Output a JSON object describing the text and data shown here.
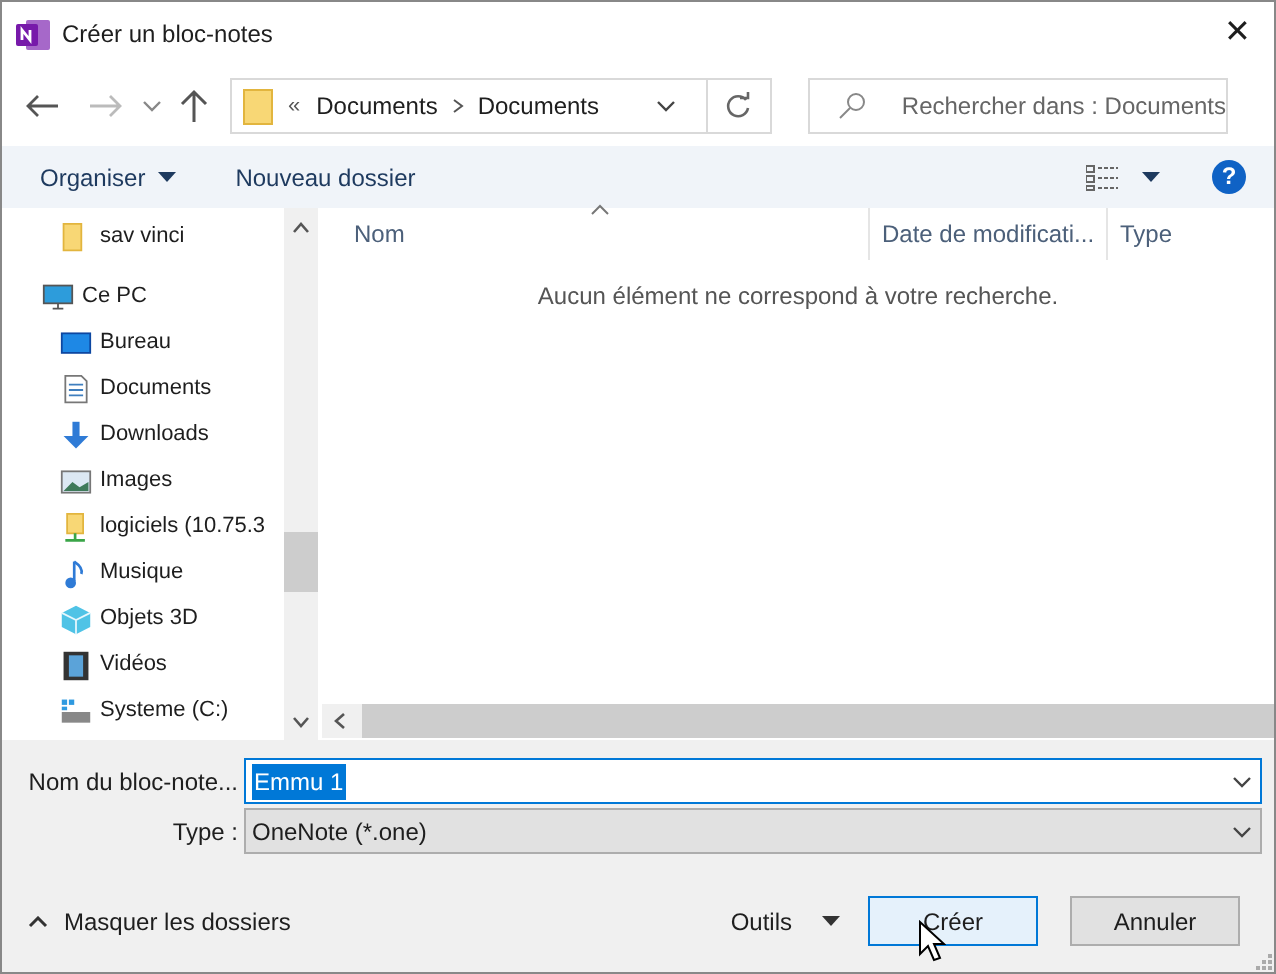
{
  "window": {
    "title": "Créer un bloc-notes",
    "close": "✕"
  },
  "address": {
    "overflow": "«",
    "crumbs": [
      "Documents",
      "Documents"
    ]
  },
  "search": {
    "placeholder": "Rechercher dans : Documents"
  },
  "toolbar": {
    "organize": "Organiser",
    "new_folder": "Nouveau dossier",
    "help": "?"
  },
  "sidebar": {
    "items": [
      {
        "label": "sav vinci",
        "kind": "folder"
      },
      {
        "label": "Ce PC",
        "kind": "pc",
        "children": [
          {
            "label": "Bureau",
            "kind": "desktop"
          },
          {
            "label": "Documents",
            "kind": "documents"
          },
          {
            "label": "Downloads",
            "kind": "download"
          },
          {
            "label": "Images",
            "kind": "images"
          },
          {
            "label": "logiciels (10.75.3",
            "kind": "network"
          },
          {
            "label": "Musique",
            "kind": "music"
          },
          {
            "label": "Objets 3D",
            "kind": "cube"
          },
          {
            "label": "Vidéos",
            "kind": "video"
          },
          {
            "label": "Systeme (C:)",
            "kind": "drive"
          }
        ]
      }
    ]
  },
  "file_list": {
    "columns": [
      "Nom",
      "Date de modificati...",
      "Type"
    ],
    "empty_message": "Aucun élément ne correspond à votre recherche."
  },
  "form": {
    "name_label": "Nom du bloc-note...",
    "name_value": "Emmu 1",
    "name_selected": true,
    "type_label": "Type :",
    "type_value": "OneNote (*.one)"
  },
  "footer": {
    "hide_folders": "Masquer les dossiers",
    "tools": "Outils",
    "buttons": [
      {
        "label": "Créer",
        "focused": true
      },
      {
        "label": "Annuler",
        "focused": false
      }
    ]
  }
}
